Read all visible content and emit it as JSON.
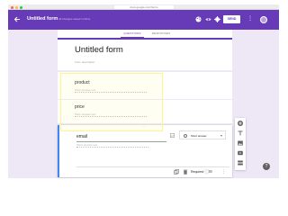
{
  "browser": {
    "url": "docs.google.com/forms"
  },
  "header": {
    "back_icon": "arrow-back-icon",
    "form_name": "Untitled form",
    "save_status": "All changes saved in Drive",
    "palette_icon": "palette-icon",
    "preview_icon": "eye-icon",
    "settings_icon": "gear-icon",
    "send_label": "SEND",
    "more_icon": "more-vert-icon",
    "accent": "#673ab7"
  },
  "tabs": {
    "questions": "QUESTIONS",
    "responses": "RESPONSES"
  },
  "form": {
    "title": "Untitled form",
    "description_placeholder": "Form description"
  },
  "questions": [
    {
      "title": "product",
      "answer_placeholder": "Short answer text"
    },
    {
      "title": "price",
      "answer_placeholder": "Short answer text"
    },
    {
      "title": "email",
      "answer_placeholder": "Short answer text",
      "type": "Short answer",
      "required_label": "Required"
    }
  ],
  "side_toolbar": {
    "icons": [
      "add-circle-icon",
      "title-text-icon",
      "image-icon",
      "video-icon",
      "section-icon"
    ]
  },
  "highlight_color": "#fff38a"
}
